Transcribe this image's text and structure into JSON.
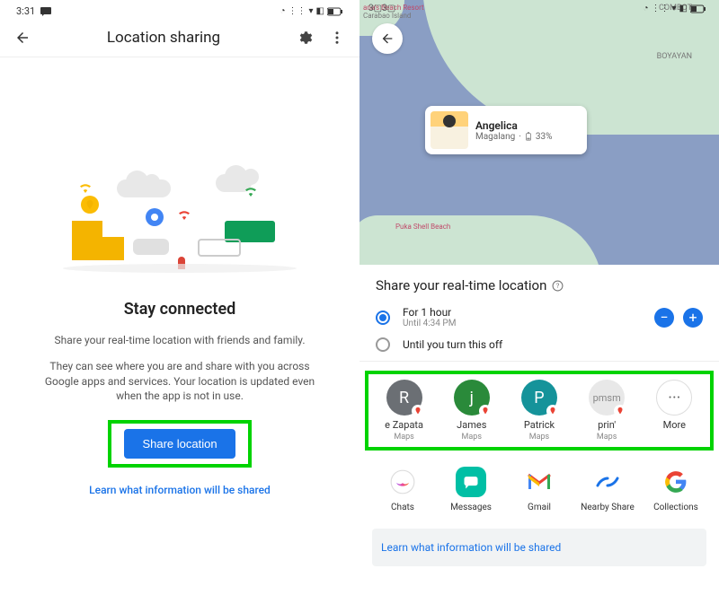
{
  "left": {
    "status": {
      "time": "3:31",
      "icons": "▲ ◉ ▾ ◧ ▢"
    },
    "header": {
      "title": "Location sharing"
    },
    "heading": "Stay connected",
    "desc1": "Share your real-time location with friends and family.",
    "desc2": "They can see where you are and share with you across Google apps and services. Your location is updated even when the app is not in use.",
    "share_button": "Share location",
    "info_link": "Learn what information will be shared"
  },
  "right": {
    "map": {
      "labels": {
        "top_left": "ana's Beach Resort",
        "top_left2": "Carabao Island",
        "top_right": "COMBOT",
        "mid_right": "BOYAYAN",
        "bottom": "Puka Shell Beach"
      }
    },
    "person": {
      "name": "Angelica",
      "location": "Magalang",
      "battery": "33%"
    },
    "sheet": {
      "title": "Share your real-time location",
      "options": [
        {
          "label": "For 1 hour",
          "sub": "Until 4:34 PM",
          "selected": true
        },
        {
          "label": "Until you turn this off",
          "sub": "",
          "selected": false
        }
      ]
    },
    "contacts": [
      {
        "name": "e Zapata",
        "sub": "Maps",
        "initial": "R",
        "color": "#6b6f74"
      },
      {
        "name": "James",
        "sub": "Maps",
        "initial": "j",
        "color": "#2a8a3a"
      },
      {
        "name": "Patrick",
        "sub": "Maps",
        "initial": "P",
        "color": "#15939a"
      },
      {
        "name": "prin'",
        "sub": "Maps",
        "initial": "pmsm",
        "color": "#e8e8e8"
      },
      {
        "name": "More",
        "sub": "",
        "initial": "···",
        "color": "#f6f6f6"
      }
    ],
    "apps": [
      {
        "name": "Chats"
      },
      {
        "name": "Messages"
      },
      {
        "name": "Gmail"
      },
      {
        "name": "Nearby Share"
      },
      {
        "name": "Collections"
      }
    ],
    "info_banner": "Learn what information will be shared"
  }
}
